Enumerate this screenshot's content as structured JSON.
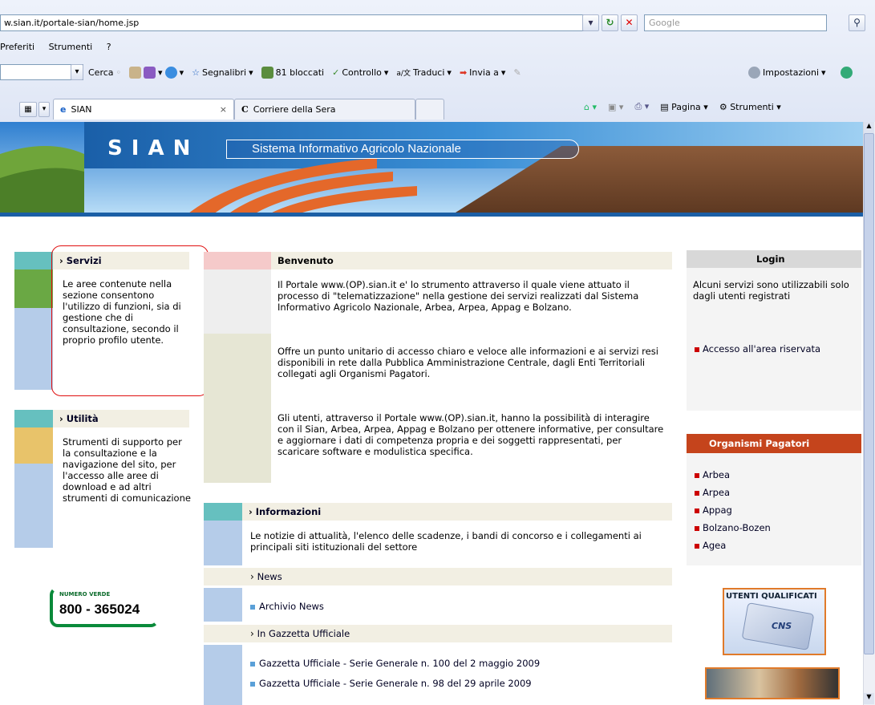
{
  "browser": {
    "url": "w.sian.it/portale-sian/home.jsp",
    "search_placeholder": "Google",
    "menu": [
      "Preferiti",
      "Strumenti",
      "?"
    ],
    "toolbar": {
      "cerca": "Cerca",
      "segnalibri": "Segnalibri",
      "bloccati": "81 bloccati",
      "controllo": "Controllo",
      "traduci": "Traduci",
      "invia": "Invia a",
      "impostazioni": "Impostazioni"
    },
    "tabs": [
      {
        "label": "SIAN",
        "close": "×"
      },
      {
        "label": "Corriere della Sera"
      }
    ],
    "command_bar": {
      "pagina": "Pagina",
      "strumenti": "Strumenti"
    }
  },
  "banner": {
    "logo": "S I A N",
    "title": "Sistema Informativo Agricolo Nazionale"
  },
  "left": {
    "servizi": {
      "title": "Servizi",
      "text": "Le aree contenute nella sezione consentono l'utilizzo di funzioni, sia di gestione che di consultazione, secondo il proprio profilo utente."
    },
    "utilita": {
      "title": "Utilità",
      "text": "Strumenti di supporto per la consultazione e la navigazione del sito, per l'accesso alle aree di download e ad altri strumenti di comunicazione"
    },
    "numero_verde": {
      "label": "NUMERO VERDE",
      "number": "800 - 365024"
    }
  },
  "center": {
    "benvenuto": {
      "title": "Benvenuto",
      "p1": "Il Portale www.(OP).sian.it e' lo strumento attraverso il quale viene attuato il processo di \"telematizzazione\" nella gestione dei servizi realizzati dal Sistema Informativo Agricolo Nazionale, Arbea, Arpea, Appag e Bolzano.",
      "p2": "Offre un punto unitario di accesso chiaro e veloce alle informazioni e ai servizi resi disponibili in rete dalla Pubblica Amministrazione Centrale, dagli Enti Territoriali collegati agli Organismi Pagatori.",
      "p3": "Gli utenti, attraverso il Portale www.(OP).sian.it, hanno la possibilità di interagire con il Sian, Arbea, Arpea, Appag e Bolzano per ottenere informative, per consultare e aggiornare i dati di competenza propria e dei soggetti rappresentati, per scaricare software e modulistica specifica."
    },
    "informazioni": {
      "title": "Informazioni",
      "text": "Le notizie di attualità, l'elenco delle scadenze, i bandi di concorso e i collegamenti ai principali siti istituzionali del settore"
    },
    "news": {
      "title": "News",
      "archivio": "Archivio News"
    },
    "gazzetta": {
      "title": "In Gazzetta Ufficiale",
      "items": [
        "Gazzetta Ufficiale - Serie Generale n. 100 del 2 maggio 2009",
        "Gazzetta Ufficiale - Serie Generale n. 98 del 29 aprile 2009"
      ]
    }
  },
  "right": {
    "login": {
      "title": "Login",
      "text": "Alcuni servizi sono utilizzabili solo dagli utenti registrati",
      "link": "Accesso all'area riservata"
    },
    "organismi": {
      "title": "Organismi Pagatori",
      "items": [
        "Arbea",
        "Arpea",
        "Appag",
        "Bolzano-Bozen",
        "Agea"
      ]
    },
    "utenti_badge": {
      "title": "UTENTI QUALIFICATI",
      "card": "CNS"
    }
  }
}
